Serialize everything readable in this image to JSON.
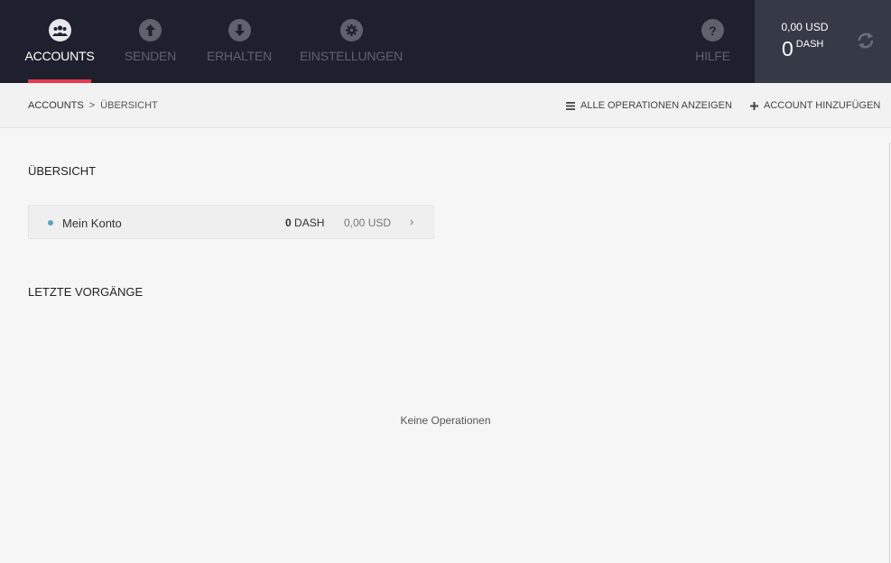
{
  "nav": {
    "items": [
      {
        "label": "ACCOUNTS",
        "icon": "users-icon",
        "active": true
      },
      {
        "label": "SENDEN",
        "icon": "arrow-up-icon",
        "active": false
      },
      {
        "label": "ERHALTEN",
        "icon": "arrow-down-icon",
        "active": false
      },
      {
        "label": "EINSTELLUNGEN",
        "icon": "gear-icon",
        "active": false
      }
    ],
    "help": {
      "label": "HILFE",
      "icon": "question-icon"
    },
    "accent_color": "#e8384f"
  },
  "balance": {
    "fiat": "0,00 USD",
    "amount": "0",
    "unit": "DASH"
  },
  "breadcrumb": {
    "root": "ACCOUNTS",
    "separator": ">",
    "current": "ÜBERSICHT"
  },
  "actions": {
    "all_operations": "ALLE OPERATIONEN ANZEIGEN",
    "add_account": "ACCOUNT HINZUFÜGEN"
  },
  "overview": {
    "title": "ÜBERSICHT",
    "accounts": [
      {
        "name": "Mein Konto",
        "amount": "0",
        "unit": "DASH",
        "fiat": "0,00 USD",
        "dot_color": "#59a4c7"
      }
    ]
  },
  "recent": {
    "title": "LETZTE VORGÄNGE",
    "empty_text": "Keine Operationen"
  }
}
